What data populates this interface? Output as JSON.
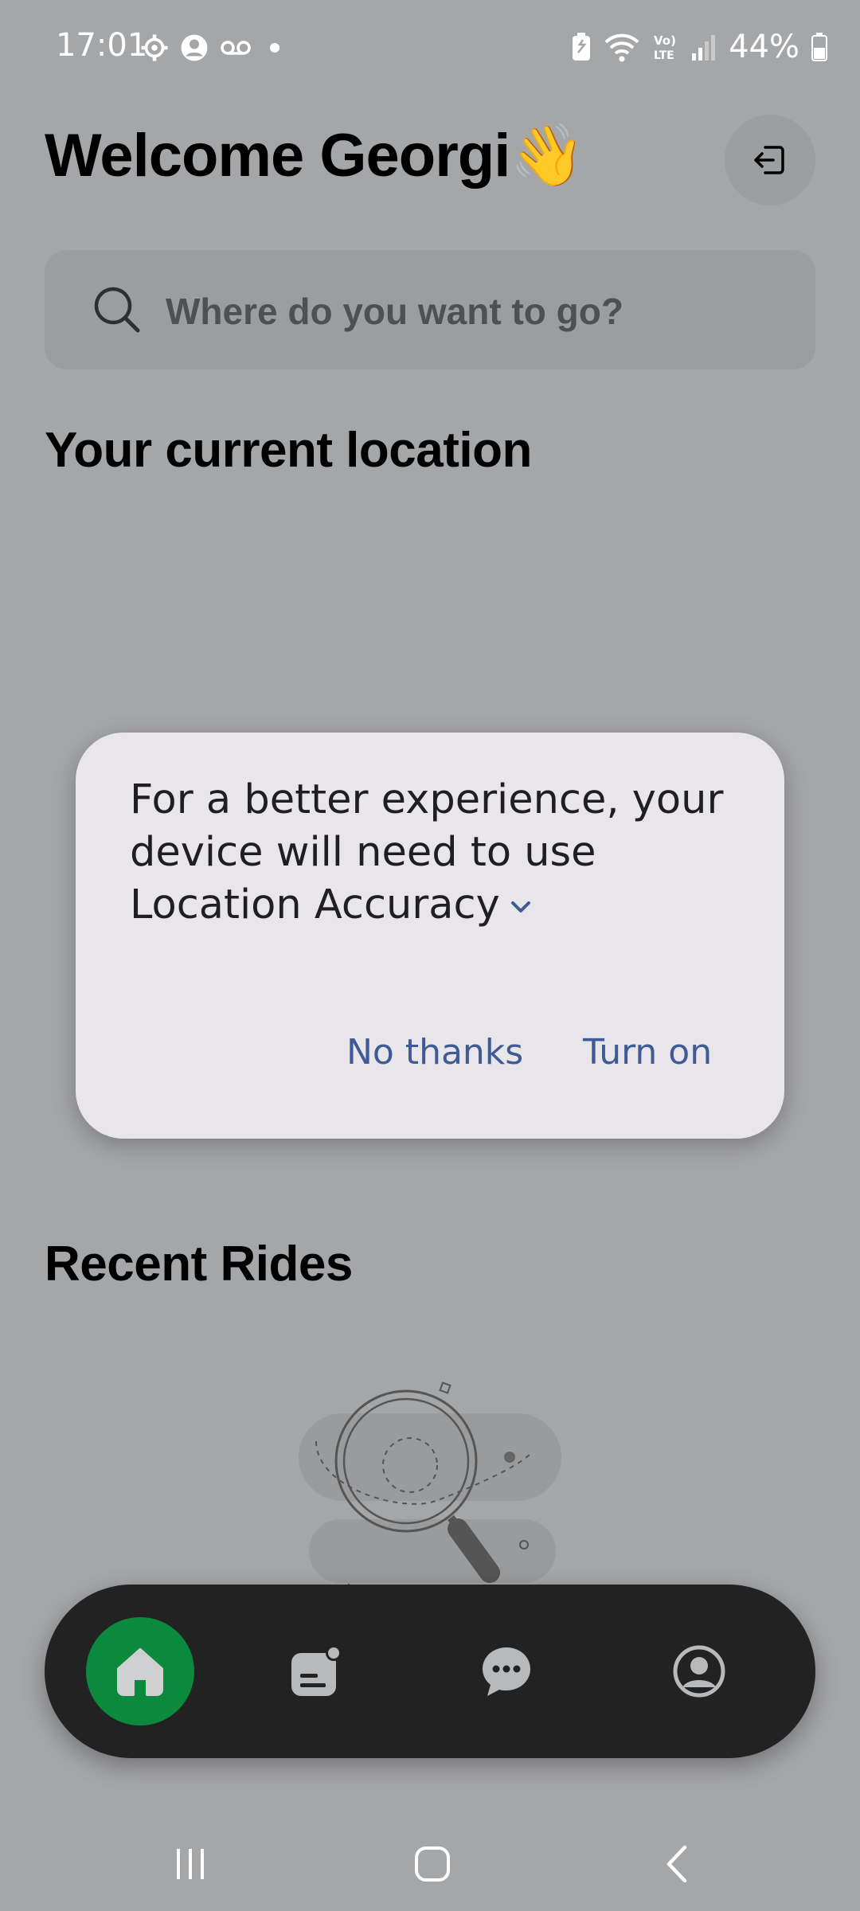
{
  "status_bar": {
    "time": "17:01",
    "battery": "44%"
  },
  "header": {
    "welcome": "Welcome Georgi",
    "wave_emoji": "👋"
  },
  "search": {
    "placeholder": "Where do you want to go?"
  },
  "sections": {
    "current_location": "Your current location",
    "recent_rides": "Recent Rides"
  },
  "dialog": {
    "message": "For a better experience, your device will need to use Location Accuracy",
    "no_thanks": "No thanks",
    "turn_on": "Turn on"
  },
  "bottom_nav": {
    "items": [
      "home",
      "rides",
      "chat",
      "profile"
    ],
    "active": "home",
    "active_color": "#0b8a3e"
  },
  "colors": {
    "scrim_background": "#a5a6a8",
    "dialog_background": "#e9e6eb",
    "dialog_button": "#3f5a94",
    "nav_background": "#222222"
  }
}
